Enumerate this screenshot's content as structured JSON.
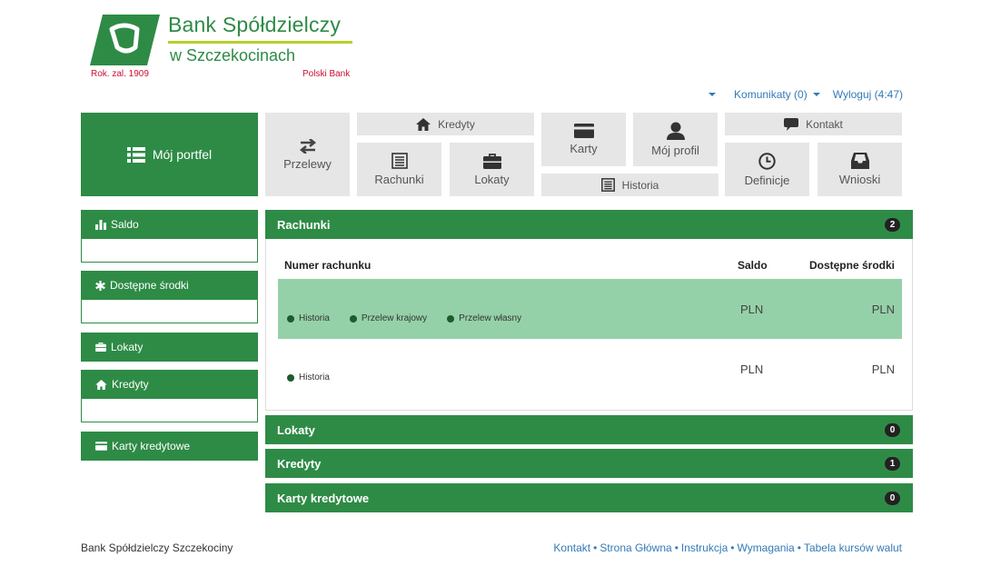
{
  "logo": {
    "name": "Bank Spółdzielczy",
    "town": "w Szczekocinach",
    "founded": "Rok. zal. 1909",
    "tagline": "Polski Bank"
  },
  "toplinks": {
    "komunikaty": "Komunikaty (0)",
    "wyloguj": "Wyloguj (4:47)"
  },
  "nav": {
    "moj_portfel": "Mój portfel",
    "przelewy": "Przelewy",
    "kredyty": "Kredyty",
    "rachunki": "Rachunki",
    "lokaty": "Lokaty",
    "karty": "Karty",
    "historia": "Historia",
    "moj_profil": "Mój profil",
    "kontakt": "Kontakt",
    "definicje": "Definicje",
    "wnioski": "Wnioski"
  },
  "sidebar": {
    "saldo": "Saldo",
    "dostepne_srodki": "Dostępne środki",
    "lokaty": "Lokaty",
    "kredyty": "Kredyty",
    "karty_kredytowe": "Karty kredytowe"
  },
  "main": {
    "rachunki": {
      "title": "Rachunki",
      "count": "2",
      "columns": {
        "numer": "Numer rachunku",
        "saldo": "Saldo",
        "dostepne": "Dostępne środki"
      },
      "rows": [
        {
          "actions": [
            "Historia",
            "Przelew krajowy",
            "Przelew własny"
          ],
          "saldo": "PLN",
          "dostepne": "PLN"
        },
        {
          "actions": [
            "Historia"
          ],
          "saldo": "PLN",
          "dostepne": "PLN"
        }
      ]
    },
    "lokaty": {
      "title": "Lokaty",
      "count": "0"
    },
    "kredyty": {
      "title": "Kredyty",
      "count": "1"
    },
    "karty_kredytowe": {
      "title": "Karty kredytowe",
      "count": "0"
    }
  },
  "footer": {
    "bank": "Bank Spółdzielczy Szczekociny",
    "links": [
      "Kontakt",
      "Strona Główna",
      "Instrukcja",
      "Wymagania",
      "Tabela kursów walut"
    ],
    "separator": "•"
  },
  "colors": {
    "brand_green": "#2e8b46",
    "row_highlight": "#95d1a8",
    "tile_gray": "#e6e6e6",
    "link_blue": "#337ab7",
    "logo_red": "#c8102e",
    "logo_rule": "#b9cf2b"
  },
  "icons": {
    "moj_portfel": "list-icon",
    "przelewy": "transfer-arrows-icon",
    "kredyty": "home-icon",
    "rachunki": "document-list-icon",
    "lokaty": "briefcase-icon",
    "karty": "credit-card-icon",
    "historia": "document-list-icon",
    "moj_profil": "user-icon",
    "kontakt": "speech-bubble-icon",
    "definicje": "clock-icon",
    "wnioski": "inbox-icon",
    "saldo": "bar-chart-icon",
    "dostepne_srodki": "asterisk-icon"
  }
}
